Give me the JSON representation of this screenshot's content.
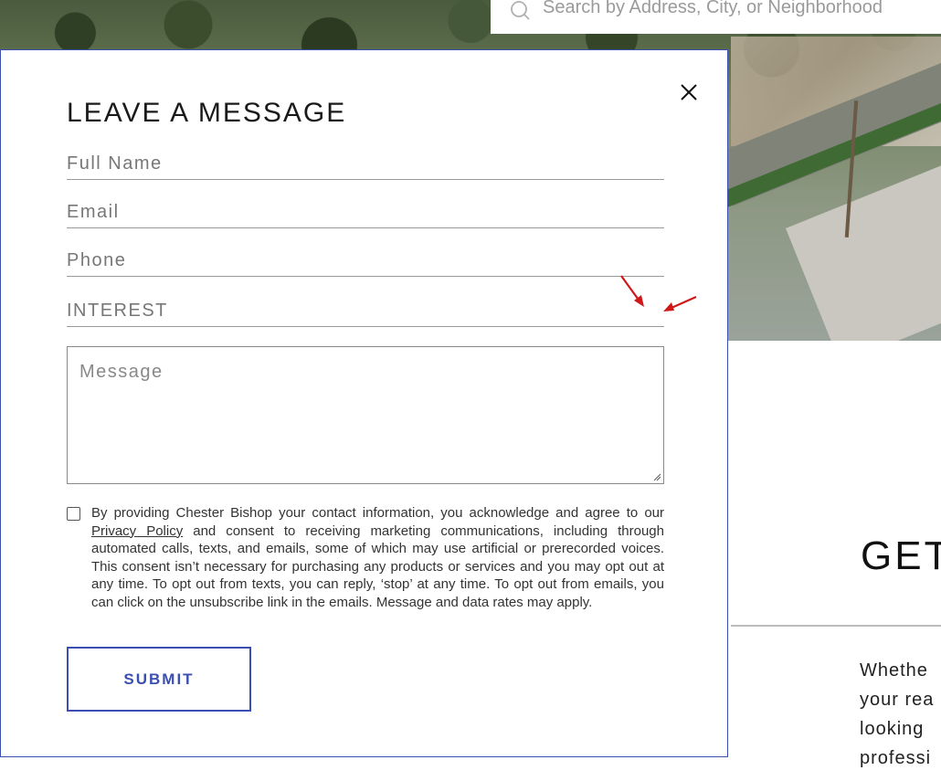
{
  "search": {
    "placeholder": "Search by Address, City, or Neighborhood"
  },
  "page": {
    "heading_partial": "GET",
    "paragraph_lines": [
      "Whethe",
      "your rea",
      "looking",
      "professi"
    ]
  },
  "modal": {
    "title": "LEAVE A MESSAGE",
    "fields": {
      "full_name_placeholder": "Full Name",
      "email_placeholder": "Email",
      "phone_placeholder": "Phone",
      "interest_label": "INTEREST",
      "message_placeholder": "Message"
    },
    "consent": {
      "text_before_link": "By providing Chester Bishop your contact information, you acknowledge and agree to our ",
      "link_text": "Privacy Policy",
      "text_after_link": " and consent to receiving marketing communications, including through automated calls, texts, and emails, some of which may use artificial or prerecorded voices. This consent isn’t necessary for purchasing any products or services and you may opt out at any time. To opt out from texts, you can reply, ‘stop’ at any time. To opt out from emails, you can click on the unsubscribe link in the emails. Message and data rates may apply.",
      "checked": false
    },
    "submit_label": "SUBMIT"
  },
  "colors": {
    "accent": "#3b4fb0",
    "annotation_arrow": "#d01818"
  }
}
